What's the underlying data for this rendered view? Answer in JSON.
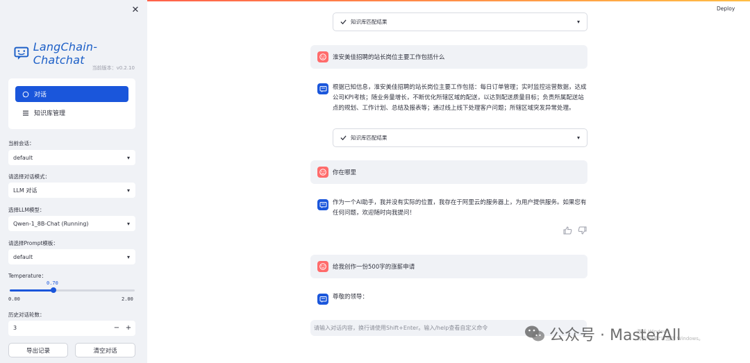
{
  "sidebar": {
    "app_name": "LangChain-Chatchat",
    "version": "当前版本：v0.2.10",
    "nav": [
      {
        "label": "对话"
      },
      {
        "label": "知识库管理"
      }
    ],
    "session_label": "当前会话：",
    "session_value": "default",
    "mode_label": "请选择对话模式：",
    "mode_value": "LLM 对话",
    "model_label": "选择LLM模型：",
    "model_value": "Qwen-1_8B-Chat (Running)",
    "prompt_label": "请选择Prompt模板：",
    "prompt_value": "default",
    "temperature_label": "Temperature：",
    "temperature_value": "0.70",
    "temperature_fraction": 0.35,
    "temperature_min": "0.00",
    "temperature_max": "2.00",
    "history_label": "历史对话轮数：",
    "history_value": "3",
    "export_label": "导出记录",
    "clear_label": "清空对话"
  },
  "header": {
    "deploy_label": "Deploy"
  },
  "chat": {
    "kb_result_label": "知识库匹配结果",
    "messages": [
      {
        "role": "user",
        "text": "淮安美佳招聘的站长岗位主要工作包括什么"
      },
      {
        "role": "assistant",
        "text": "根据已知信息，淮安美佳招聘的站长岗位主要工作包括：每日订单管理；实时监控运营数据，达成公司KPI考核；随业务量增长，不断优化所辖区域的配送，以达到配送质量目标；负责所属配送站点的规划、工作计划、总结及报表等；通过线上线下处理客户问题；所辖区域突发异常处理。"
      },
      {
        "role": "user",
        "text": "你在哪里"
      },
      {
        "role": "assistant",
        "text": "作为一个AI助手，我并没有实际的位置，我存在于阿里云的服务器上，为用户提供服务。如果您有任何问题，欢迎随时向我提问！"
      },
      {
        "role": "user",
        "text": "给我创作一份500字的涨薪申请"
      },
      {
        "role": "assistant",
        "text": "尊敬的领导："
      }
    ],
    "input_placeholder": "请输入对话内容，换行请使用Shift+Enter。输入/help查看自定义命令"
  },
  "overlay": {
    "watermark_text": "公众号 · MasterAll",
    "windows_line1": "激活 Windows",
    "windows_line2": "转到\"设置\"以激活 Windows。"
  },
  "colors": {
    "accent": "#1a56db",
    "user_avatar": "#ff6b6b",
    "sidebar_bg": "#f0f2f6"
  }
}
